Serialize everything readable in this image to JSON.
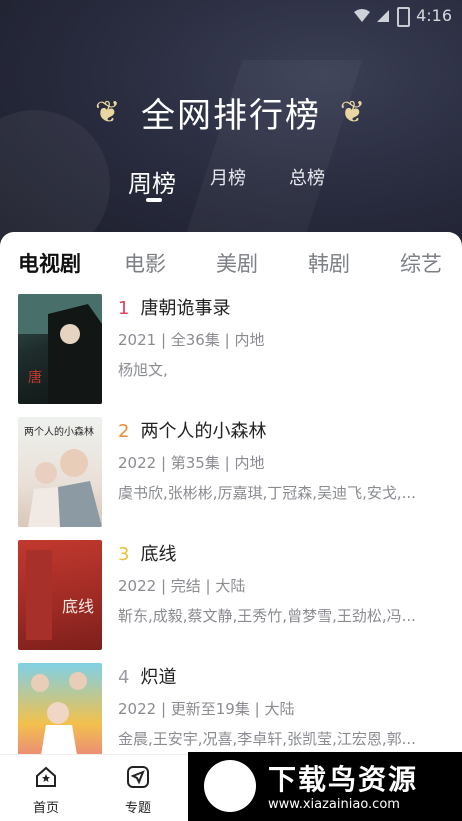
{
  "status": {
    "time": "4:16"
  },
  "header": {
    "title": "全网排行榜",
    "periods": [
      "周榜",
      "月榜",
      "总榜"
    ],
    "active_period": "周榜"
  },
  "categories": [
    "电视剧",
    "电影",
    "美剧",
    "韩剧",
    "综艺"
  ],
  "active_category": "电视剧",
  "items": [
    {
      "rank": "1",
      "title": "唐朝诡事录",
      "meta": "2021 | 全36集 | 内地",
      "actors": "杨旭文,"
    },
    {
      "rank": "2",
      "title": "两个人的小森林",
      "meta": "2022 | 第35集 | 内地",
      "actors": "虞书欣,张彬彬,厉嘉琪,丁冠森,吴迪飞,安戈,..."
    },
    {
      "rank": "3",
      "title": "底线",
      "meta": "2022 | 完结 | 大陆",
      "actors": "靳东,成毅,蔡文静,王秀竹,曾梦雪,王劲松,冯..."
    },
    {
      "rank": "4",
      "title": "炽道",
      "meta": "2022 | 更新至19集 | 大陆",
      "actors": "金晨,王安宇,况喜,李卓轩,张凯莹,江宏恩,郭..."
    }
  ],
  "rank_colors": [
    "#e1435e",
    "#ef8b32",
    "#ebc13a",
    "#9a9ca2"
  ],
  "tabs": [
    "首页",
    "专题"
  ],
  "watermark": {
    "name": "下载鸟资源",
    "url": "www.xiazainiao.com"
  }
}
